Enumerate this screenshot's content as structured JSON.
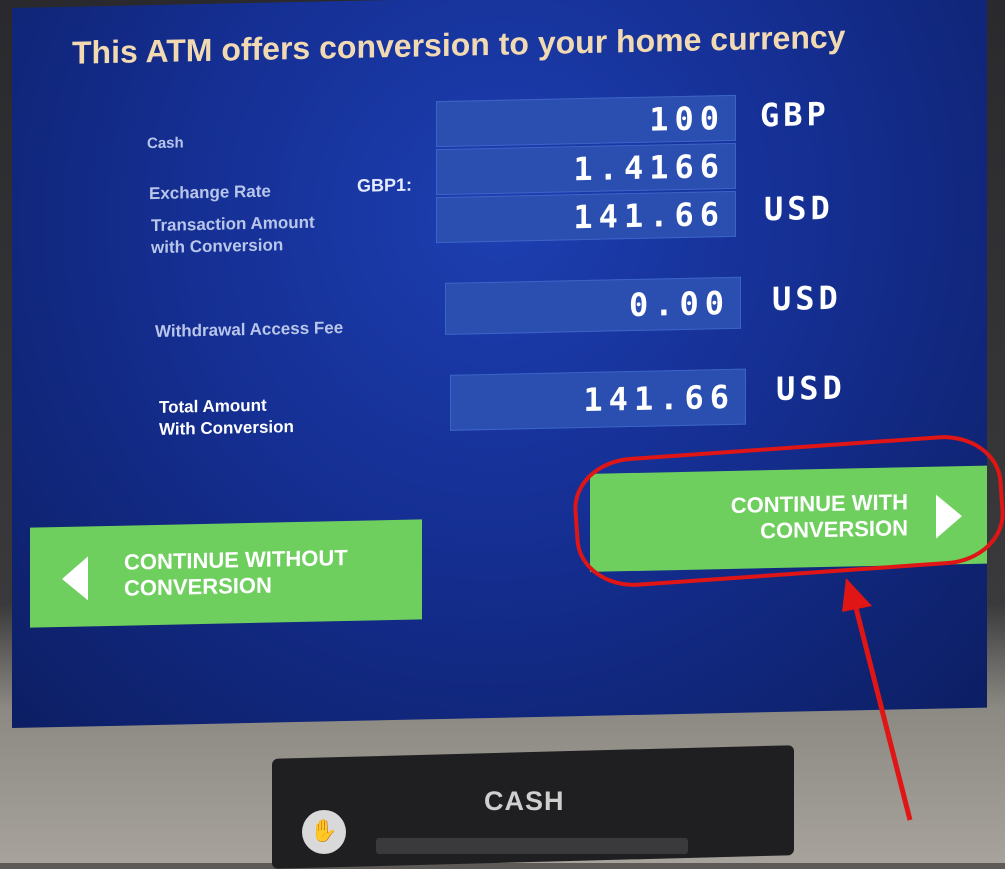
{
  "screen": {
    "title": "This ATM offers conversion to your home currency"
  },
  "rows": {
    "cash": {
      "label": "Cash",
      "value": "100",
      "currency": "GBP"
    },
    "rate": {
      "label": "Exchange Rate",
      "prefix": "GBP1:",
      "value": "1.4166"
    },
    "transaction": {
      "label_line1": "Transaction Amount",
      "label_line2": "with Conversion",
      "value": "141.66",
      "currency": "USD"
    },
    "fee": {
      "label": "Withdrawal Access Fee",
      "value": "0.00",
      "currency": "USD"
    },
    "total": {
      "label_line1": "Total Amount",
      "label_line2": "With Conversion",
      "value": "141.66",
      "currency": "USD"
    }
  },
  "buttons": {
    "without": {
      "line1": "CONTINUE WITHOUT",
      "line2": "CONVERSION"
    },
    "with": {
      "line1": "CONTINUE WITH",
      "line2": "CONVERSION"
    }
  },
  "machine": {
    "cash_slot_label": "CASH",
    "cash_icon": "hand-icon"
  },
  "colors": {
    "screen_blue": "#152f93",
    "button_green": "#6fcf5e",
    "title_color": "#f1d9b2",
    "highlight_red": "#e01515"
  }
}
